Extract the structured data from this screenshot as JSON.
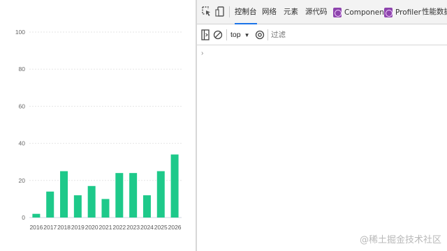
{
  "chart_data": {
    "type": "bar",
    "categories": [
      "2016",
      "2017",
      "2018",
      "2019",
      "2020",
      "2021",
      "2022",
      "2023",
      "2024",
      "2025",
      "2026"
    ],
    "values": [
      2,
      14,
      25,
      12,
      17,
      10,
      24,
      24,
      12,
      25,
      34
    ],
    "ylim": [
      0,
      100
    ],
    "yticks": [
      "0",
      "20",
      "40",
      "60",
      "80",
      "100"
    ],
    "grid": true,
    "bar_color": "#1ec98a",
    "title": "",
    "xlabel": "",
    "ylabel": ""
  },
  "devtools": {
    "tabs": [
      {
        "label": "控制台",
        "active": true
      },
      {
        "label": "网络",
        "active": false
      },
      {
        "label": "元素",
        "active": false
      },
      {
        "label": "源代码",
        "active": false
      }
    ],
    "ext_tabs": [
      {
        "label": "Components"
      },
      {
        "label": "Profiler"
      }
    ],
    "overflow_tab": "性能数据分",
    "context": "top",
    "filter_placeholder": "过滤",
    "prompt_glyph": "›",
    "accent": "#1a73e8"
  },
  "watermark": "@稀土掘金技术社区"
}
